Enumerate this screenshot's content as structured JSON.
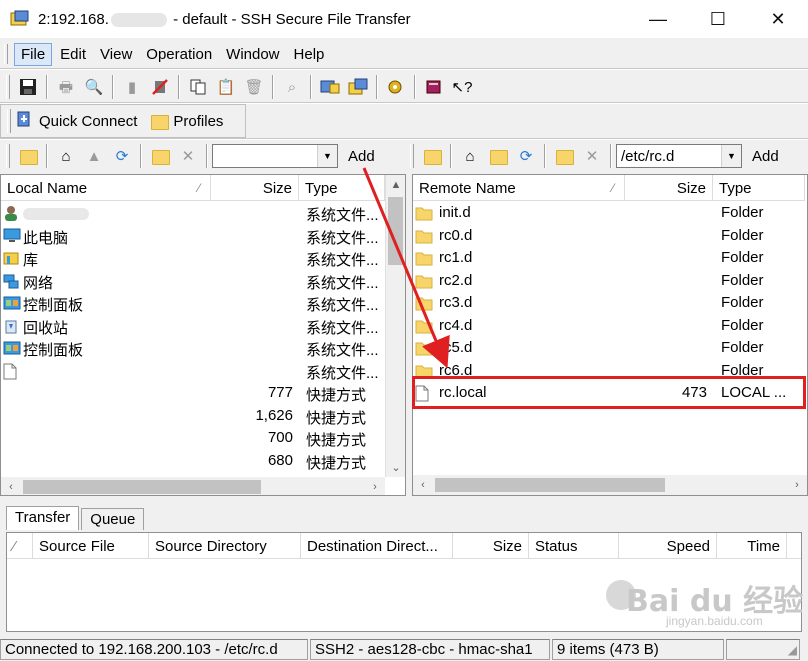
{
  "window": {
    "title_prefix": "2:192.168.",
    "title_suffix": " - default - SSH Secure File Transfer",
    "minimize": "—",
    "maximize": "☐",
    "close": "✕"
  },
  "menu": {
    "items": [
      "File",
      "Edit",
      "View",
      "Operation",
      "Window",
      "Help"
    ]
  },
  "quick_bar": {
    "quick_connect": "Quick Connect",
    "profiles": "Profiles"
  },
  "local": {
    "path_value": "",
    "add_label": "Add",
    "columns": {
      "name": "Local Name",
      "size": "Size",
      "type": "Type"
    },
    "rows": [
      {
        "name": "",
        "size": "",
        "type": "系统文件...",
        "icon": "user-icon"
      },
      {
        "name": "此电脑",
        "size": "",
        "type": "系统文件...",
        "icon": "computer-icon"
      },
      {
        "name": "库",
        "size": "",
        "type": "系统文件...",
        "icon": "library-icon"
      },
      {
        "name": "网络",
        "size": "",
        "type": "系统文件...",
        "icon": "network-icon"
      },
      {
        "name": "控制面板",
        "size": "",
        "type": "系统文件...",
        "icon": "control-panel-icon"
      },
      {
        "name": "回收站",
        "size": "",
        "type": "系统文件...",
        "icon": "recycle-bin-icon"
      },
      {
        "name": "控制面板",
        "size": "",
        "type": "系统文件...",
        "icon": "control-panel-icon"
      },
      {
        "name": "",
        "size": "",
        "type": "系统文件...",
        "icon": "file-icon"
      },
      {
        "name": "",
        "size": "777",
        "type": "快捷方式",
        "icon": "shortcut-icon"
      },
      {
        "name": "",
        "size": "1,626",
        "type": "快捷方式",
        "icon": "shortcut-icon"
      },
      {
        "name": "",
        "size": "700",
        "type": "快捷方式",
        "icon": "shortcut-icon"
      },
      {
        "name": "",
        "size": "680",
        "type": "快捷方式",
        "icon": "shortcut-icon"
      }
    ]
  },
  "remote": {
    "path_value": "/etc/rc.d",
    "add_label": "Add",
    "columns": {
      "name": "Remote Name",
      "size": "Size",
      "type": "Type"
    },
    "rows": [
      {
        "name": "init.d",
        "size": "",
        "type": "Folder",
        "icon": "folder-icon"
      },
      {
        "name": "rc0.d",
        "size": "",
        "type": "Folder",
        "icon": "folder-icon"
      },
      {
        "name": "rc1.d",
        "size": "",
        "type": "Folder",
        "icon": "folder-icon"
      },
      {
        "name": "rc2.d",
        "size": "",
        "type": "Folder",
        "icon": "folder-icon"
      },
      {
        "name": "rc3.d",
        "size": "",
        "type": "Folder",
        "icon": "folder-icon"
      },
      {
        "name": "rc4.d",
        "size": "",
        "type": "Folder",
        "icon": "folder-icon"
      },
      {
        "name": "rc5.d",
        "size": "",
        "type": "Folder",
        "icon": "folder-icon"
      },
      {
        "name": "rc6.d",
        "size": "",
        "type": "Folder",
        "icon": "folder-icon"
      },
      {
        "name": "rc.local",
        "size": "473",
        "type": "LOCAL ...",
        "icon": "file-icon"
      }
    ]
  },
  "transfer": {
    "tabs": [
      "Transfer",
      "Queue"
    ],
    "columns": [
      "Source File",
      "Source Directory",
      "Destination Direct...",
      "Size",
      "Status",
      "Speed",
      "Time"
    ]
  },
  "status": {
    "connection": "Connected to 192.168.200.103 - /etc/rc.d",
    "cipher": "SSH2 - aes128-cbc - hmac-sha1",
    "items": "9 items (473 B)"
  },
  "watermark": {
    "main": "Bai du 经验",
    "sub": "jingyan.baidu.com"
  },
  "colors": {
    "highlight": "#e02020",
    "folder": "#f7d56b",
    "selection_menu": "#dbe8f8"
  }
}
